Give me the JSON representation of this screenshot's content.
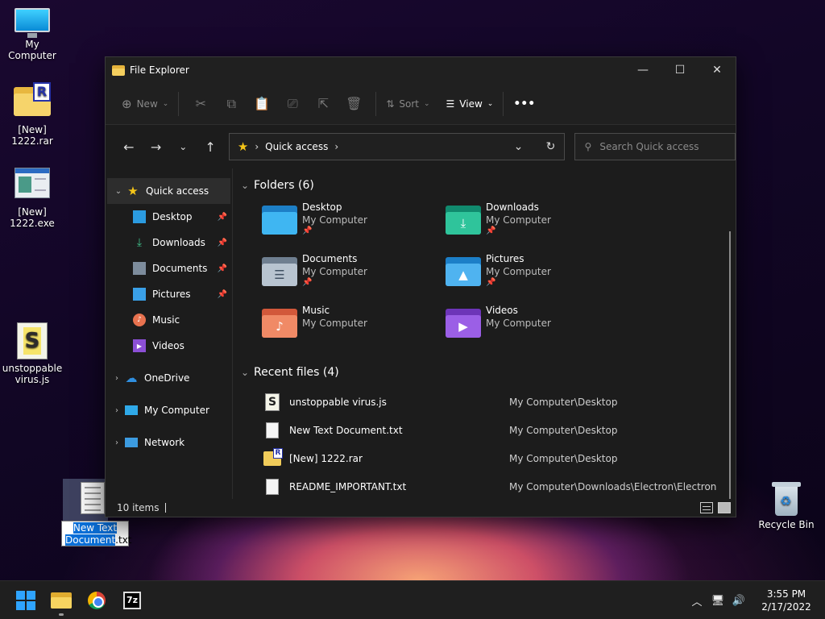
{
  "desktop": {
    "icons": [
      {
        "label": "My Computer"
      },
      {
        "label": "[New]\n1222.rar",
        "line1": "[New]",
        "line2": "1222.rar"
      },
      {
        "label": "[New]\n1222.exe",
        "line1": "[New]",
        "line2": "1222.exe"
      },
      {
        "label": "unstoppable virus.js",
        "line1": "unstoppable",
        "line2": "virus.js"
      },
      {
        "label": "Recycle Bin"
      }
    ],
    "rename": {
      "selected": "New Text Document",
      "ext": ".txt",
      "line1": "New Text",
      "line2": "Document"
    }
  },
  "window": {
    "title": "File Explorer",
    "toolbar": {
      "new": "New",
      "sort": "Sort",
      "view": "View",
      "more": "•••"
    },
    "address": {
      "crumb": "Quick access"
    },
    "search": {
      "placeholder": "Search Quick access"
    },
    "nav": {
      "quick_access": "Quick access",
      "items": [
        {
          "label": "Desktop",
          "pinned": true
        },
        {
          "label": "Downloads",
          "pinned": true
        },
        {
          "label": "Documents",
          "pinned": true
        },
        {
          "label": "Pictures",
          "pinned": true
        },
        {
          "label": "Music",
          "pinned": false
        },
        {
          "label": "Videos",
          "pinned": false
        }
      ],
      "onedrive": "OneDrive",
      "mycomputer": "My Computer",
      "network": "Network"
    },
    "folders": {
      "header": "Folders (6)",
      "items": [
        {
          "name": "Desktop",
          "location": "My Computer",
          "pinned": true
        },
        {
          "name": "Downloads",
          "location": "My Computer",
          "pinned": true
        },
        {
          "name": "Documents",
          "location": "My Computer",
          "pinned": true
        },
        {
          "name": "Pictures",
          "location": "My Computer",
          "pinned": true
        },
        {
          "name": "Music",
          "location": "My Computer",
          "pinned": false
        },
        {
          "name": "Videos",
          "location": "My Computer",
          "pinned": false
        }
      ]
    },
    "recent": {
      "header": "Recent files (4)",
      "items": [
        {
          "name": "unstoppable virus.js",
          "path": "My Computer\\Desktop"
        },
        {
          "name": "New Text Document.txt",
          "path": "My Computer\\Desktop"
        },
        {
          "name": "[New] 1222.rar",
          "path": "My Computer\\Desktop"
        },
        {
          "name": "README_IMPORTANT.txt",
          "path": "My Computer\\Downloads\\Electron\\Electron"
        }
      ]
    },
    "status": {
      "count": "10 items"
    }
  },
  "taskbar": {
    "time": "3:55 PM",
    "date": "2/17/2022",
    "sevenzip_label": "7z"
  },
  "colors": {
    "accent": "#2fa4ff",
    "selection": "#0a6fd8"
  }
}
